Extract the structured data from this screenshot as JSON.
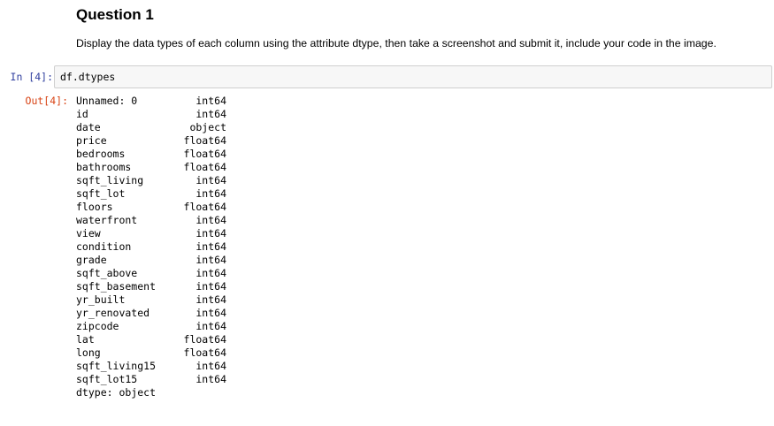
{
  "markdown": {
    "heading": "Question 1",
    "instruction": "Display the data types of each column using the attribute dtype, then take a screenshot and submit it, include your code in the image."
  },
  "input_cell": {
    "prompt": "In [4]:",
    "code": "df.dtypes"
  },
  "output_cell": {
    "prompt": "Out[4]:",
    "rows": [
      {
        "name": "Unnamed: 0",
        "dtype": "int64"
      },
      {
        "name": "id",
        "dtype": "int64"
      },
      {
        "name": "date",
        "dtype": "object"
      },
      {
        "name": "price",
        "dtype": "float64"
      },
      {
        "name": "bedrooms",
        "dtype": "float64"
      },
      {
        "name": "bathrooms",
        "dtype": "float64"
      },
      {
        "name": "sqft_living",
        "dtype": "int64"
      },
      {
        "name": "sqft_lot",
        "dtype": "int64"
      },
      {
        "name": "floors",
        "dtype": "float64"
      },
      {
        "name": "waterfront",
        "dtype": "int64"
      },
      {
        "name": "view",
        "dtype": "int64"
      },
      {
        "name": "condition",
        "dtype": "int64"
      },
      {
        "name": "grade",
        "dtype": "int64"
      },
      {
        "name": "sqft_above",
        "dtype": "int64"
      },
      {
        "name": "sqft_basement",
        "dtype": "int64"
      },
      {
        "name": "yr_built",
        "dtype": "int64"
      },
      {
        "name": "yr_renovated",
        "dtype": "int64"
      },
      {
        "name": "zipcode",
        "dtype": "int64"
      },
      {
        "name": "lat",
        "dtype": "float64"
      },
      {
        "name": "long",
        "dtype": "float64"
      },
      {
        "name": "sqft_living15",
        "dtype": "int64"
      },
      {
        "name": "sqft_lot15",
        "dtype": "int64"
      }
    ],
    "footer": "dtype: object"
  },
  "colors": {
    "in_prompt": "#303f9f",
    "out_prompt": "#d84315",
    "input_background": "#f7f7f7",
    "input_border": "#cfcfcf"
  }
}
